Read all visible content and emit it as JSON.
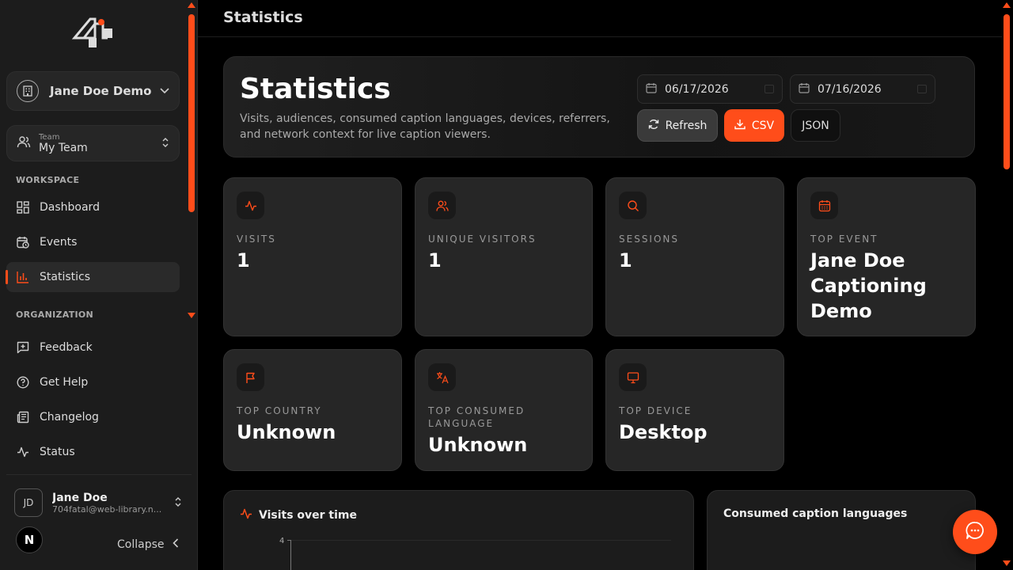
{
  "colors": {
    "accent": "#ff4d1a",
    "sidebar_bg": "#1c1c1c",
    "card_bg": "#262626",
    "page_bg": "#000000"
  },
  "sidebar": {
    "account": {
      "label": "Jane Doe Demo",
      "icon": "building-icon"
    },
    "team": {
      "small_label": "Team",
      "name": "My Team",
      "icon": "users-icon"
    },
    "workspace_label": "WORKSPACE",
    "workspace_items": [
      {
        "label": "Dashboard",
        "icon": "grid-icon"
      },
      {
        "label": "Events",
        "icon": "calendar-clock-icon"
      },
      {
        "label": "Statistics",
        "icon": "bar-chart-icon",
        "active": true
      }
    ],
    "organization_label": "ORGANIZATION",
    "org_items": [
      {
        "label": "Feedback",
        "icon": "message-plus-icon"
      },
      {
        "label": "Get Help",
        "icon": "help-circle-icon"
      },
      {
        "label": "Changelog",
        "icon": "newspaper-icon"
      },
      {
        "label": "Status",
        "icon": "activity-icon"
      }
    ],
    "user": {
      "initials": "JD",
      "name": "Jane Doe",
      "email": "704fatal@web-library.n..."
    },
    "next_badge": "N",
    "collapse_label": "Collapse"
  },
  "topbar": {
    "title": "Statistics"
  },
  "hero": {
    "title": "Statistics",
    "description": "Visits, audiences, consumed caption languages, devices, referrers, and network context for live caption viewers.",
    "date_from": "06/17/2026",
    "date_to": "07/16/2026",
    "refresh_label": "Refresh",
    "csv_label": "CSV",
    "json_label": "JSON"
  },
  "cards": [
    {
      "label": "VISITS",
      "value": "1",
      "icon": "activity-icon"
    },
    {
      "label": "UNIQUE VISITORS",
      "value": "1",
      "icon": "users-icon"
    },
    {
      "label": "SESSIONS",
      "value": "1",
      "icon": "search-icon"
    },
    {
      "label": "TOP EVENT",
      "value": "Jane Doe Captioning Demo",
      "icon": "calendar-icon"
    },
    {
      "label": "TOP COUNTRY",
      "value": "Unknown",
      "icon": "flag-icon"
    },
    {
      "label": "TOP CONSUMED LANGUAGE",
      "value": "Unknown",
      "icon": "languages-icon"
    },
    {
      "label": "TOP DEVICE",
      "value": "Desktop",
      "icon": "monitor-icon"
    }
  ],
  "panels": {
    "visits_title": "Visits over time",
    "visits_axis_max": "4",
    "languages_title": "Consumed caption languages"
  }
}
